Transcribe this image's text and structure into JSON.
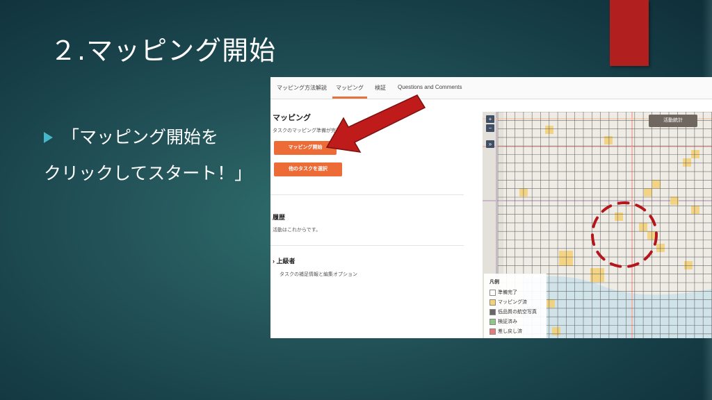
{
  "slide": {
    "title": "２.マッピング開始",
    "bullet_line1": "「マッピング開始を",
    "bullet_line2": "クリックしてスタート！」"
  },
  "screenshot": {
    "tabs": [
      {
        "label": "マッピング方法解説"
      },
      {
        "label": "マッピング",
        "active": true
      },
      {
        "label": "検証"
      },
      {
        "label": "Questions and Comments"
      }
    ],
    "mapping": {
      "heading": "マッピング",
      "description": "タスクのマッピング準備が完了し",
      "start_button": "マッピング開始",
      "other_task_button": "他のタスクを選択"
    },
    "history": {
      "heading": "履歴",
      "text": "活動はこれからです。"
    },
    "advanced": {
      "heading": "上級者",
      "text": "タスクの補足情報と編集オプション"
    },
    "map": {
      "zoom_in": "+",
      "zoom_out": "−",
      "expand": "»",
      "stats_button": "活動統計",
      "legend": {
        "title": "凡例",
        "items": [
          {
            "label": "準備完了",
            "color": "#ffffff"
          },
          {
            "label": "マッピング済",
            "color": "#f3d27a"
          },
          {
            "label": "低品質の航空写真",
            "color": "#666666"
          },
          {
            "label": "検証済み",
            "color": "#8fc68a"
          },
          {
            "label": "差し戻し済",
            "color": "#e57b7b"
          }
        ]
      }
    }
  },
  "colors": {
    "accent_orange": "#ec6b37",
    "arrow_red": "#c01b1b",
    "deco_red": "#b21f1f",
    "bullet_teal": "#46b7c9"
  }
}
